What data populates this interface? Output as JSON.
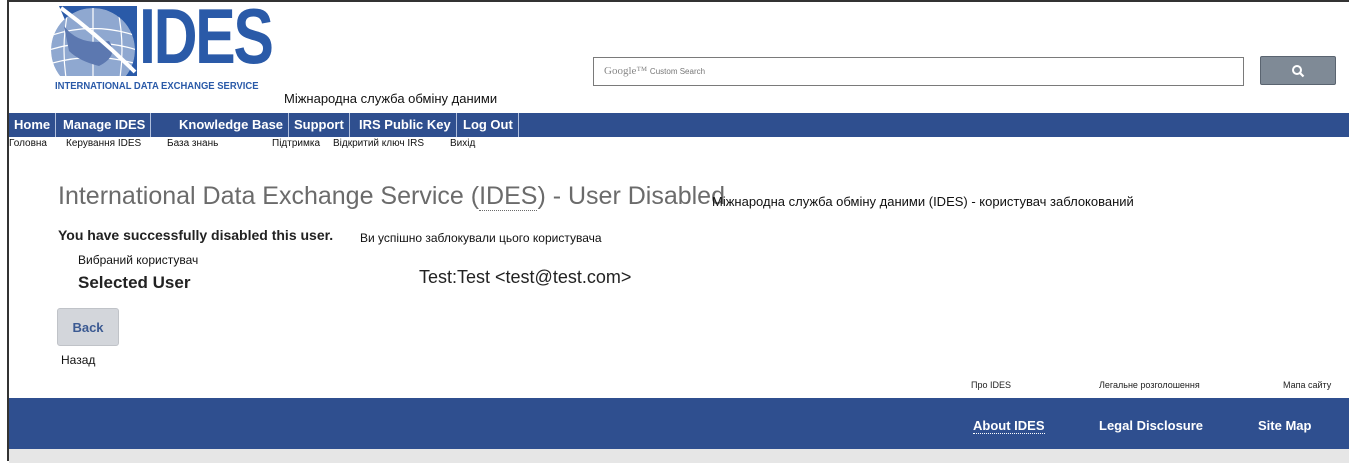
{
  "logo": {
    "wordmark": "IDES",
    "subtitle": "INTERNATIONAL DATA EXCHANGE SERVICE",
    "subtitle_ua": "Міжнародна служба обміну даними"
  },
  "search": {
    "placeholder_brand": "Google™",
    "placeholder_text": "Custom Search",
    "button_icon": "search-icon"
  },
  "nav": {
    "items": [
      {
        "label": "Home",
        "label_ua": "Головна"
      },
      {
        "label": "Manage IDES",
        "label_ua": "Керування IDES"
      },
      {
        "label": "Knowledge Base",
        "label_ua": "База знань"
      },
      {
        "label": "Support",
        "label_ua": "Підтримка"
      },
      {
        "label": "IRS Public Key",
        "label_ua": "Відкритий ключ IRS"
      },
      {
        "label": "Log Out",
        "label_ua": "Вихід"
      }
    ]
  },
  "main": {
    "title_prefix": "International Data Exchange Service (",
    "title_abbr": "IDES",
    "title_suffix": ") - User Disabled",
    "title_ua": "Міжнародна служба обміну даними (IDES) - користувач заблокований",
    "success": "You have successfully disabled this user.",
    "success_ua": "Ви успішно заблокували цього користувача",
    "selected_user_ua": "Вибраний користувач",
    "selected_user_label": "Selected User",
    "selected_user_value": "Test:Test <test@test.com>",
    "back_label": "Back",
    "back_ua": "Назад"
  },
  "footer": {
    "about": "About IDES",
    "about_ua": "Про IDES",
    "legal": "Legal Disclosure",
    "legal_ua": "Легальне розголошення",
    "sitemap": "Site Map",
    "sitemap_ua": "Мапа сайту"
  },
  "colors": {
    "nav_bg": "#2f4f8f",
    "brand_blue": "#2a5aa8",
    "title_gray": "#6b6b6b"
  }
}
